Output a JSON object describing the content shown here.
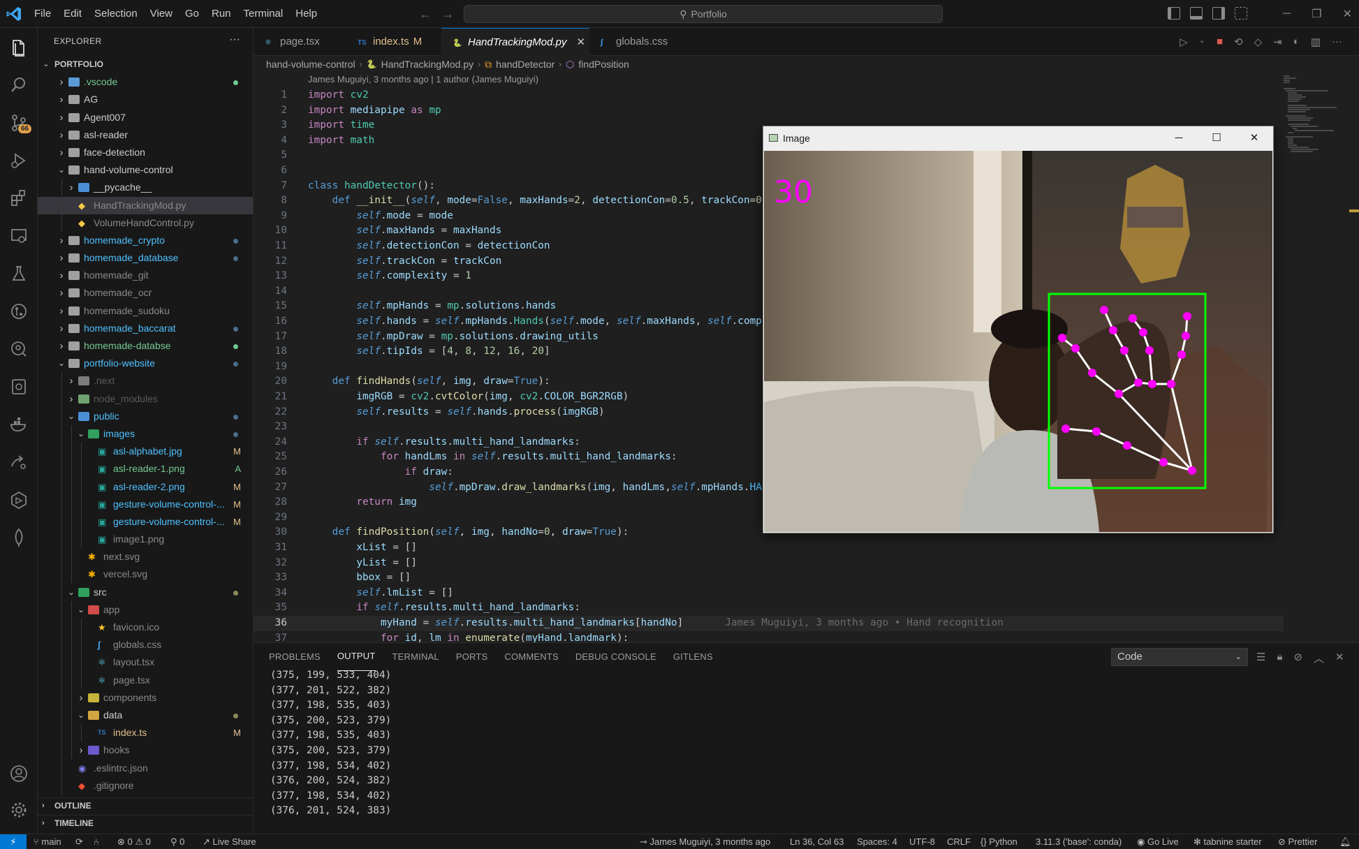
{
  "titlebar": {
    "menu": [
      "File",
      "Edit",
      "Selection",
      "View",
      "Go",
      "Run",
      "Terminal",
      "Help"
    ],
    "search_text": "Portfolio"
  },
  "activitybar": {
    "icons": [
      "explorer-icon",
      "search-icon",
      "source-control-icon",
      "run-debug-icon",
      "extensions-icon",
      "remote-explorer-icon",
      "testing-icon",
      "github-icon",
      "gitlens-icon",
      "docker-icon",
      "live-share-icon",
      "database-icon",
      "mongodb-icon",
      "accounts-icon",
      "manage-icon"
    ],
    "scm_badge": "66"
  },
  "sidebar": {
    "title": "EXPLORER",
    "more": "···",
    "root": "PORTFOLIO",
    "rows": [
      {
        "name": ".vscode",
        "type": "folder",
        "depth": 1,
        "open": false,
        "color": "#73c991",
        "status": "dot",
        "status_color": "#73c991",
        "icon_color": "#5b9bd5"
      },
      {
        "name": "AG",
        "type": "folder",
        "depth": 1,
        "open": false,
        "color": "#cccccc",
        "icon_color": "#a0a0a0"
      },
      {
        "name": "Agent007",
        "type": "folder",
        "depth": 1,
        "open": false,
        "color": "#cccccc",
        "icon_color": "#a0a0a0"
      },
      {
        "name": "asl-reader",
        "type": "folder",
        "depth": 1,
        "open": false,
        "color": "#cccccc",
        "icon_color": "#a0a0a0"
      },
      {
        "name": "face-detection",
        "type": "folder",
        "depth": 1,
        "open": false,
        "color": "#cccccc",
        "icon_color": "#a0a0a0"
      },
      {
        "name": "hand-volume-control",
        "type": "folder",
        "depth": 1,
        "open": true,
        "color": "#cccccc",
        "icon_color": "#a0a0a0"
      },
      {
        "name": "__pycache__",
        "type": "folder",
        "depth": 2,
        "open": false,
        "color": "#cccccc",
        "icon_color": "#4a8fd6"
      },
      {
        "name": "HandTrackingMod.py",
        "type": "py",
        "depth": 2,
        "color": "#8a8a8a",
        "selected": true
      },
      {
        "name": "VolumeHandControl.py",
        "type": "py",
        "depth": 2,
        "color": "#8a8a8a"
      },
      {
        "name": "homemade_crypto",
        "type": "folder",
        "depth": 1,
        "open": false,
        "color": "#4fc1ff",
        "status": "dot",
        "status_color": "#4a6d8c",
        "icon_color": "#a0a0a0"
      },
      {
        "name": "homemade_database",
        "type": "folder",
        "depth": 1,
        "open": false,
        "color": "#4fc1ff",
        "status": "dot",
        "status_color": "#4a6d8c",
        "icon_color": "#a0a0a0"
      },
      {
        "name": "homemade_git",
        "type": "folder",
        "depth": 1,
        "open": false,
        "color": "#8a8a8a",
        "icon_color": "#a0a0a0"
      },
      {
        "name": "homemade_ocr",
        "type": "folder",
        "depth": 1,
        "open": false,
        "color": "#8a8a8a",
        "icon_color": "#a0a0a0"
      },
      {
        "name": "homemade_sudoku",
        "type": "folder",
        "depth": 1,
        "open": false,
        "color": "#8a8a8a",
        "icon_color": "#a0a0a0"
      },
      {
        "name": "homemade_baccarat",
        "type": "folder",
        "depth": 1,
        "open": false,
        "color": "#4fc1ff",
        "status": "dot",
        "status_color": "#4a6d8c",
        "icon_color": "#a0a0a0"
      },
      {
        "name": "homemade-databse",
        "type": "folder",
        "depth": 1,
        "open": false,
        "color": "#73c991",
        "status": "dot",
        "status_color": "#73c991",
        "icon_color": "#a0a0a0"
      },
      {
        "name": "portfolio-website",
        "type": "folder",
        "depth": 1,
        "open": true,
        "color": "#4fc1ff",
        "status": "dot",
        "status_color": "#4a6d8c",
        "icon_color": "#a0a0a0"
      },
      {
        "name": ".next",
        "type": "folder",
        "depth": 2,
        "open": false,
        "color": "#5a5a5a",
        "icon_color": "#7d7d7d"
      },
      {
        "name": "node_modules",
        "type": "folder",
        "depth": 2,
        "open": false,
        "color": "#5a5a5a",
        "icon_color": "#6fa36f"
      },
      {
        "name": "public",
        "type": "folder",
        "depth": 2,
        "open": true,
        "color": "#4fc1ff",
        "status": "dot",
        "status_color": "#4a6d8c",
        "icon_color": "#4a8fd6"
      },
      {
        "name": "images",
        "type": "folder",
        "depth": 3,
        "open": true,
        "color": "#4fc1ff",
        "status": "dot",
        "status_color": "#4a6d8c",
        "icon_color": "#31a05f"
      },
      {
        "name": "asl-alphabet.jpg",
        "type": "img",
        "depth": 4,
        "color": "#4fc1ff",
        "status": "M",
        "status_color": "#e2c08d"
      },
      {
        "name": "asl-reader-1.png",
        "type": "img",
        "depth": 4,
        "color": "#73c991",
        "status": "A",
        "status_color": "#73c991"
      },
      {
        "name": "asl-reader-2.png",
        "type": "img",
        "depth": 4,
        "color": "#4fc1ff",
        "status": "M",
        "status_color": "#e2c08d"
      },
      {
        "name": "gesture-volume-control-...",
        "type": "img",
        "depth": 4,
        "color": "#4fc1ff",
        "status": "M",
        "status_color": "#e2c08d"
      },
      {
        "name": "gesture-volume-control-...",
        "type": "img",
        "depth": 4,
        "color": "#4fc1ff",
        "status": "M",
        "status_color": "#e2c08d"
      },
      {
        "name": "image1.png",
        "type": "img",
        "depth": 4,
        "color": "#8a8a8a"
      },
      {
        "name": "next.svg",
        "type": "svg",
        "depth": 3,
        "color": "#8a8a8a"
      },
      {
        "name": "vercel.svg",
        "type": "svg",
        "depth": 3,
        "color": "#8a8a8a"
      },
      {
        "name": "src",
        "type": "folder",
        "depth": 2,
        "open": true,
        "color": "#cccccc",
        "status": "dot",
        "status_color": "#8b8b5a",
        "icon_color": "#31a05f"
      },
      {
        "name": "app",
        "type": "folder",
        "depth": 3,
        "open": true,
        "color": "#8a8a8a",
        "icon_color": "#d24c4c"
      },
      {
        "name": "favicon.ico",
        "type": "ico",
        "depth": 4,
        "color": "#8a8a8a"
      },
      {
        "name": "globals.css",
        "type": "css",
        "depth": 4,
        "color": "#8a8a8a"
      },
      {
        "name": "layout.tsx",
        "type": "tsx",
        "depth": 4,
        "color": "#8a8a8a"
      },
      {
        "name": "page.tsx",
        "type": "tsx",
        "depth": 4,
        "color": "#8a8a8a"
      },
      {
        "name": "components",
        "type": "folder",
        "depth": 3,
        "open": false,
        "color": "#8a8a8a",
        "icon_color": "#c5b33a"
      },
      {
        "name": "data",
        "type": "folder",
        "depth": 3,
        "open": true,
        "color": "#cccccc",
        "status": "dot",
        "status_color": "#8b8b5a",
        "icon_color": "#d1a542"
      },
      {
        "name": "index.ts",
        "type": "ts",
        "depth": 4,
        "color": "#e2c08d",
        "status": "M",
        "status_color": "#e2c08d"
      },
      {
        "name": "hooks",
        "type": "folder",
        "depth": 3,
        "open": false,
        "color": "#8a8a8a",
        "icon_color": "#6a5acd"
      },
      {
        "name": ".eslintrc.json",
        "type": "eslint",
        "depth": 2,
        "color": "#8a8a8a"
      },
      {
        "name": ".gitignore",
        "type": "git",
        "depth": 2,
        "color": "#8a8a8a"
      }
    ],
    "outline": "OUTLINE",
    "timeline": "TIMELINE"
  },
  "tabs": [
    {
      "label": "page.tsx",
      "icon": "react-icon",
      "modified": ""
    },
    {
      "label": "index.ts",
      "icon": "TS",
      "modified": "M"
    },
    {
      "label": "HandTrackingMod.py",
      "icon": "python-icon",
      "modified": "",
      "active": true
    },
    {
      "label": "globals.css",
      "icon": "css-icon",
      "modified": ""
    }
  ],
  "breadcrumb": [
    "hand-volume-control",
    "HandTrackingMod.py",
    "handDetector",
    "findPosition"
  ],
  "editor": {
    "blame_header": "James Muguiyi, 3 months ago | 1 author (James Muguiyi)",
    "current_line": 36,
    "inline_blame": "James Muguiyi, 3 months ago • Hand recognition",
    "lines": [
      "import cv2",
      "import mediapipe as mp",
      "import time",
      "import math",
      "",
      "",
      "class handDetector():",
      "    def __init__(self, mode=False, maxHands=2, detectionCon=0.5, trackCon=0.5):",
      "        self.mode = mode",
      "        self.maxHands = maxHands",
      "        self.detectionCon = detectionCon",
      "        self.trackCon = trackCon",
      "        self.complexity = 1",
      "",
      "        self.mpHands = mp.solutions.hands",
      "        self.hands = self.mpHands.Hands(self.mode, self.maxHands, self.complexity, self.detectionCon, self.trackCon)",
      "        self.mpDraw = mp.solutions.drawing_utils",
      "        self.tipIds = [4, 8, 12, 16, 20]",
      "",
      "    def findHands(self, img, draw=True):",
      "        imgRGB = cv2.cvtColor(img, cv2.COLOR_BGR2RGB)",
      "        self.results = self.hands.process(imgRGB)",
      "",
      "        if self.results.multi_hand_landmarks:",
      "            for handLms in self.results.multi_hand_landmarks:",
      "                if draw:",
      "                    self.mpDraw.draw_landmarks(img, handLms,self.mpHands.HAND_CONNECTIONS)",
      "        return img",
      "",
      "    def findPosition(self, img, handNo=0, draw=True):",
      "        xList = []",
      "        yList = []",
      "        bbox = []",
      "        self.lmList = []",
      "        if self.results.multi_hand_landmarks:",
      "            myHand = self.results.multi_hand_landmarks[handNo]",
      "            for id, lm in enumerate(myHand.landmark):"
    ]
  },
  "image_window": {
    "title": "Image",
    "fps": "30"
  },
  "panel": {
    "tabs": [
      "PROBLEMS",
      "OUTPUT",
      "TERMINAL",
      "PORTS",
      "COMMENTS",
      "DEBUG CONSOLE",
      "GITLENS"
    ],
    "active_tab": "OUTPUT",
    "channel": "Code",
    "output": [
      "(375, 199, 533, 404)",
      "(377, 201, 522, 382)",
      "(377, 198, 535, 403)",
      "(375, 200, 523, 379)",
      "(377, 198, 535, 403)",
      "(375, 200, 523, 379)",
      "(377, 198, 534, 402)",
      "(376, 200, 524, 382)",
      "(377, 198, 534, 402)",
      "(376, 201, 524, 383)"
    ]
  },
  "statusbar": {
    "branch": "main",
    "errors": "0",
    "warnings": "0",
    "ports": "0",
    "live_share": "Live Share",
    "blame": "James Muguiyi, 3 months ago",
    "position": "Ln 36, Col 63",
    "spaces": "Spaces: 4",
    "encoding": "UTF-8",
    "eol": "CRLF",
    "language": "Python",
    "interpreter": "3.11.3 ('base': conda)",
    "go_live": "Go Live",
    "tabnine": "tabnine starter",
    "prettier": "Prettier"
  }
}
